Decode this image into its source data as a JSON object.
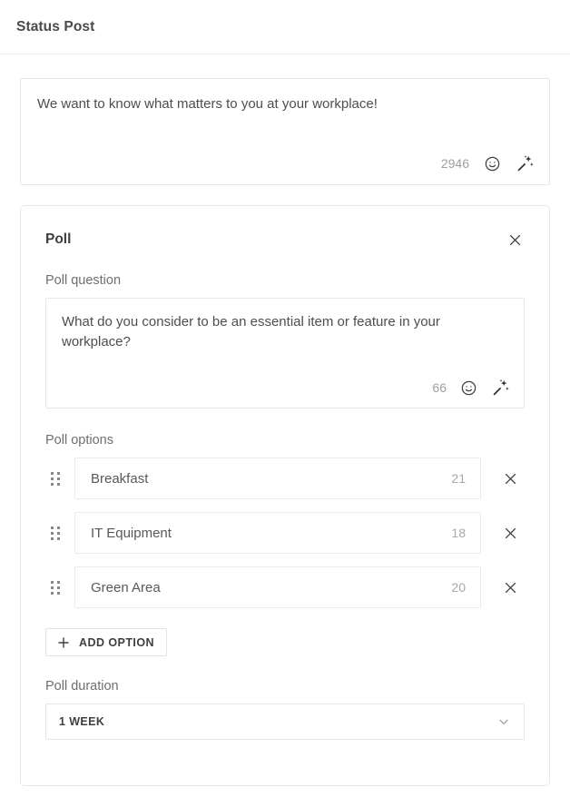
{
  "header": {
    "title": "Status Post"
  },
  "composer": {
    "text": "We want to know what matters to you at your workplace!",
    "char_count": "2946",
    "emoji_icon": "smiley-face-icon",
    "ai_icon": "magic-wand-sparkles-icon"
  },
  "poll": {
    "title": "Poll",
    "close_icon": "close-icon",
    "question_label": "Poll question",
    "question_text": "What do you consider to be an essential item or feature in your workplace?",
    "question_char_count": "66",
    "options_label": "Poll options",
    "options": [
      {
        "label": "Breakfast",
        "count": "21",
        "drag_icon": "drag-handle-icon",
        "remove_icon": "close-icon"
      },
      {
        "label": "IT Equipment",
        "count": "18",
        "drag_icon": "drag-handle-icon",
        "remove_icon": "close-icon"
      },
      {
        "label": "Green Area",
        "count": "20",
        "drag_icon": "drag-handle-icon",
        "remove_icon": "close-icon"
      }
    ],
    "add_option_label": "ADD OPTION",
    "add_option_icon": "plus-icon",
    "duration_label": "Poll duration",
    "duration_value": "1 WEEK",
    "duration_chevron_icon": "chevron-down-icon"
  },
  "colors": {
    "border": "#e4e6e8",
    "text": "#3c4043",
    "muted": "#9aa0a6"
  }
}
